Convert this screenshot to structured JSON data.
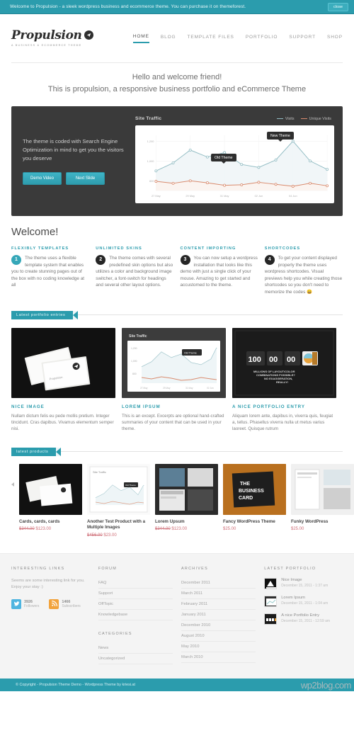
{
  "notification": {
    "message": "Welcome to Propulsion - a sleek wordpress business and ecommerce theme. You can purchase it on themeforest.",
    "close_label": "close",
    "bg_color": "#2b9cad"
  },
  "header": {
    "logo_text": "Propulsion",
    "logo_tagline": "A BUSINESS & ECOMMERCE THEME",
    "nav": [
      {
        "label": "HOME",
        "active": true
      },
      {
        "label": "BLOG",
        "active": false
      },
      {
        "label": "TEMPLATE FILES",
        "active": false
      },
      {
        "label": "PORTFOLIO",
        "active": false
      },
      {
        "label": "SUPPORT",
        "active": false
      },
      {
        "label": "SHOP",
        "active": false
      }
    ]
  },
  "intro": {
    "line1": "Hello and welcome friend!",
    "line2": "This is propulsion, a responsive business portfolio and eCommerce Theme"
  },
  "slider": {
    "caption": "The theme is coded with Search Engine Optimization in mind to get you the visitors you deserve",
    "button_primary": "Demo Video",
    "button_secondary": "Next Slide",
    "tooltip_old": "Old Theme",
    "tooltip_new": "New Theme"
  },
  "chart_data": {
    "type": "line",
    "title": "Site Traffic",
    "xlabel": "",
    "ylabel": "",
    "grid": true,
    "legend_position": "top-right",
    "x": [
      "27 May",
      "28 May",
      "29 May",
      "30 May",
      "31 May",
      "01 Jun",
      "02 Jun",
      "03 Jun",
      "04 Jun",
      "05 Jun",
      "06 Jun"
    ],
    "tick_labels_x": [
      "27 May",
      "29 May",
      "31 May",
      "02 Jun",
      "04 Jun"
    ],
    "tick_labels_y": [
      "1,200",
      "1,000",
      "800"
    ],
    "ylim": [
      700,
      1260
    ],
    "series": [
      {
        "name": "Visits",
        "color": "#93bdc4",
        "values": [
          900,
          980,
          1110,
          1040,
          1085,
          965,
          935,
          1010,
          1200,
          1000,
          915
        ]
      },
      {
        "name": "Unique Visits",
        "color": "#d98b6e",
        "values": [
          795,
          775,
          800,
          780,
          755,
          760,
          785,
          765,
          745,
          775,
          750
        ]
      }
    ]
  },
  "welcome": {
    "heading": "Welcome!",
    "features": [
      {
        "number": "1",
        "title": "FLEXIBLY TEMPLATES",
        "body": "The theme uses a flexible template system that enables you to create stunning pages out of the box with no coding knowledge at all"
      },
      {
        "number": "2",
        "title": "UNLIMITED SKINS",
        "body": "The theme comes with several predefined skin options but also utilizes a color and background image switcher, a font-switch for headings and several other layout options."
      },
      {
        "number": "3",
        "title": "CONTENT IMPORTING",
        "body": "You can now setup a wordpress installation that looks like this demo with just a single click of your mouse. Amazing to get started and accustomed to the theme."
      },
      {
        "number": "4",
        "title": "SHORTCODES",
        "body": "To get your content displayed properly the theme uses wordpress shortcodes. Visual previews help you while creating those shortcodes so you don't need to memorize the codes 😄"
      }
    ]
  },
  "portfolio_section": {
    "ribbon": "Latest portfolio entries",
    "items": [
      {
        "title": "NICE IMAGE",
        "excerpt": "Nullam dictum felis eu pede mollis pretium. Integer tincidunt. Cras dapibus. Vivamus elementum semper nisi."
      },
      {
        "title": "LOREM IPSUM",
        "excerpt": "This is an except. Excerpts are optional hand-crafted summaries of your content that can be used in your theme."
      },
      {
        "title": "A NICE PORTFOLIO ENTRY",
        "excerpt": "Aliquam lorem ante, dapibus in, viverra quis, feugiat a, tellus. Phasellus viverra nulla ut metus varius laoreet. Quisque rutrum"
      }
    ],
    "counter_digits": [
      "100",
      "00",
      "00"
    ],
    "counter_caption": "MILLIONS OF LAYOUT/COLOR COMBINATIONS POSSIBLE? NO EXAGGERATION, REALLY!"
  },
  "products_section": {
    "ribbon": "latest products",
    "items": [
      {
        "name": "Cards, cards, cards",
        "old_price": "$344.00",
        "price": "$123.00"
      },
      {
        "name": "Another Test Product with a Multiple Images",
        "old_price": "$456.00",
        "price": "$23.00"
      },
      {
        "name": "Lorem Upsum",
        "old_price": "$344.00",
        "price": "$123.00"
      },
      {
        "name": "Fancy WordPress Theme",
        "old_price": "",
        "price": "$25.00"
      },
      {
        "name": "Funky WordPress",
        "old_price": "",
        "price": "$25.00"
      }
    ]
  },
  "footer": {
    "interesting": {
      "title": "INTERESTING LINKS",
      "body": "Seems are some interesting link for you. Enjoy your stay :)",
      "social": [
        {
          "icon": "twitter-icon",
          "count": "3926",
          "label": "Followers",
          "color": "#4fb5e0"
        },
        {
          "icon": "rss-icon",
          "count": "1466",
          "label": "Subscribers",
          "color": "#f2a33c"
        }
      ]
    },
    "forum": {
      "title": "FORUM",
      "items": [
        "FAQ",
        "Support",
        "OffTopic",
        "Knowledgebase"
      ]
    },
    "categories": {
      "title": "CATEGORIES",
      "items": [
        "News",
        "Uncategorized"
      ]
    },
    "archives": {
      "title": "ARCHIVES",
      "items": [
        "December 2011",
        "March 2011",
        "February 2011",
        "January 2011",
        "December 2010",
        "August 2010",
        "May 2010",
        "March 2010"
      ]
    },
    "latest_portfolio": {
      "title": "LATEST PORTFOLIO",
      "items": [
        {
          "name": "Nice Image",
          "date": "December 15, 2011 - 1:37 am"
        },
        {
          "name": "Lorem Ipsum",
          "date": "December 15, 2011 - 1:04 am"
        },
        {
          "name": "A nice Portfolio Entry",
          "date": "December 15, 2011 - 12:59 am"
        }
      ]
    }
  },
  "copyright": {
    "text": "© Copyright - Propulsion Theme Demo - Wordpress Theme by kriesi.at"
  },
  "watermark": "wp2blog.com"
}
